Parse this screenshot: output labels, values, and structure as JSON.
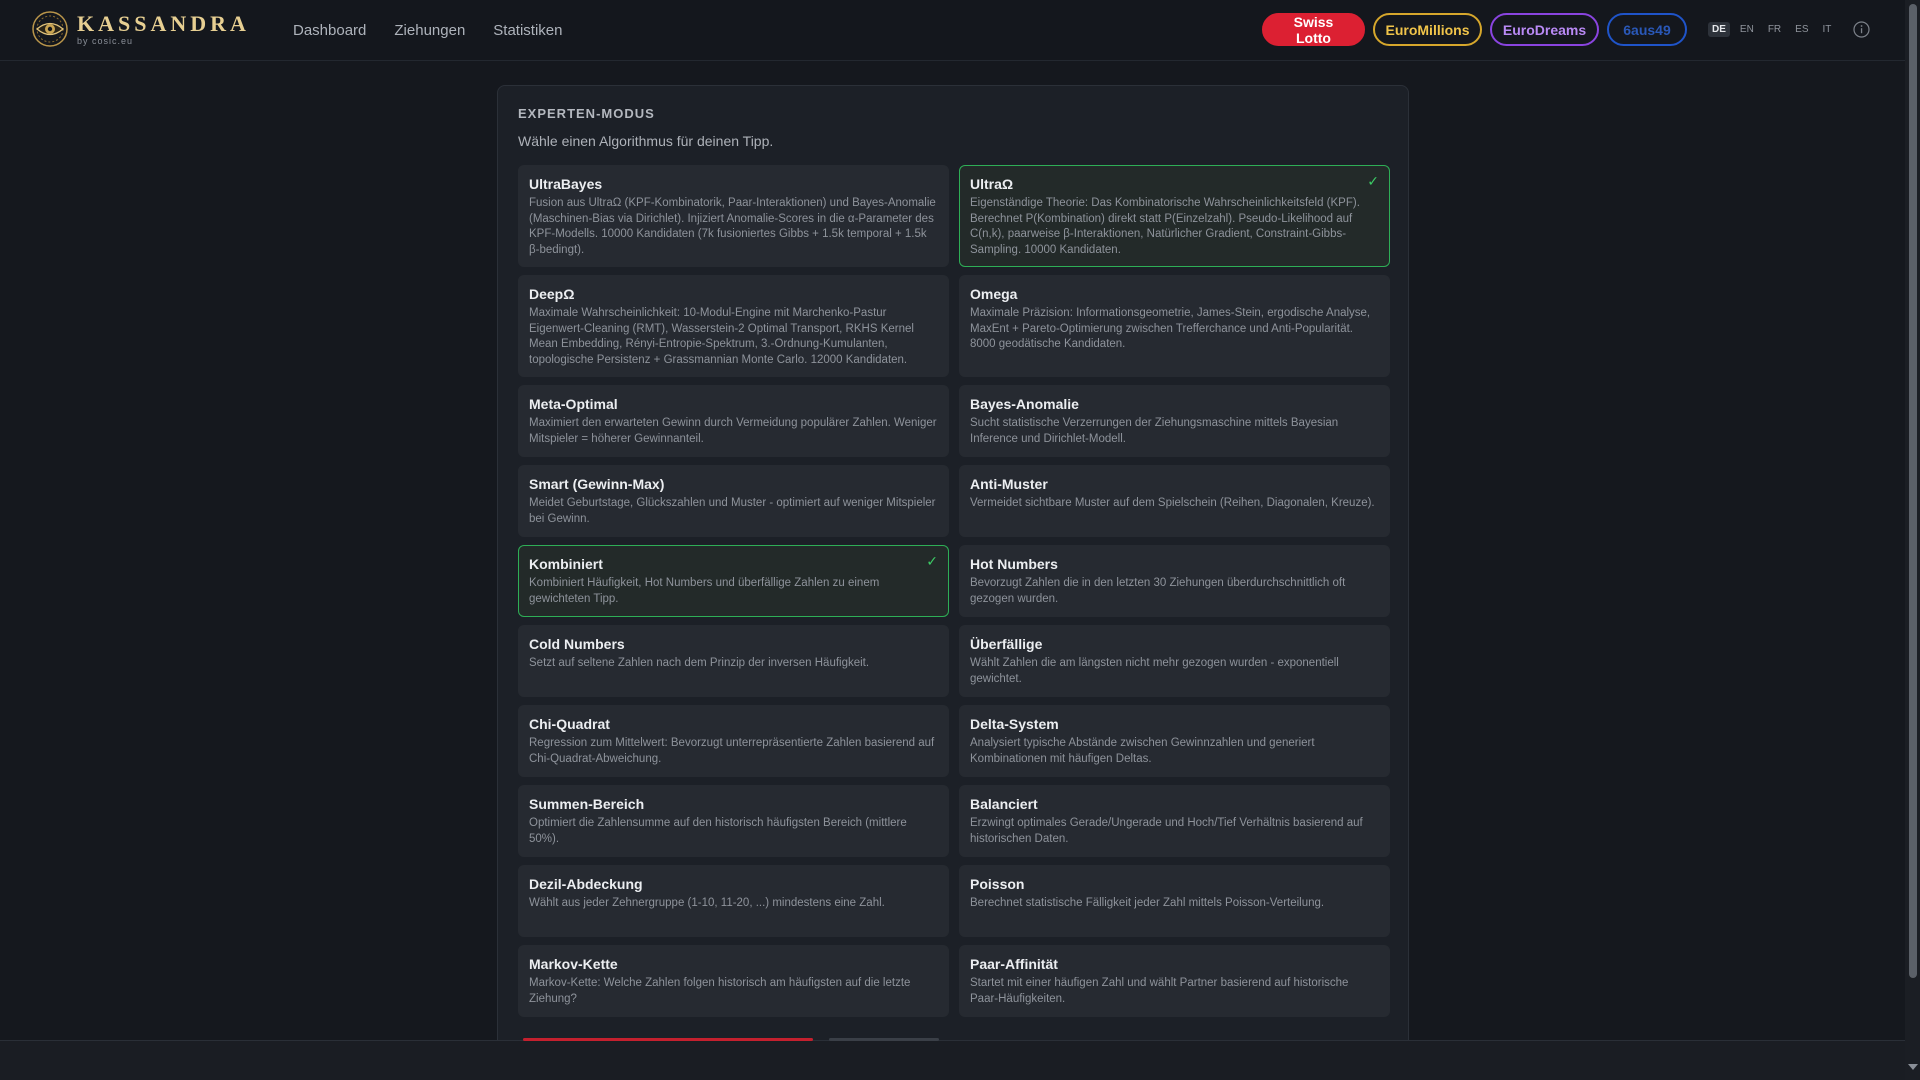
{
  "app": {
    "logo_name": "KASSANDRA",
    "logo_sub": "by cosic.eu"
  },
  "nav": {
    "items": [
      "Dashboard",
      "Ziehungen",
      "Statistiken"
    ]
  },
  "games": [
    {
      "label": "Swiss Lotto",
      "color": "#dc2032"
    },
    {
      "label": "EuroMillions",
      "color": "#d6a72c"
    },
    {
      "label": "EuroDreams",
      "color": "#8a44e0"
    },
    {
      "label": "6aus49",
      "color": "#1f54c9"
    }
  ],
  "languages": {
    "items": [
      "DE",
      "EN",
      "FR",
      "ES",
      "IT"
    ],
    "active": "DE"
  },
  "icons": {
    "info": "info-icon",
    "check": "check-icon",
    "logo": "eye-logo-icon"
  },
  "panel": {
    "title": "EXPERTEN-MODUS",
    "subtitle": "Wähle einen Algorithmus für deinen Tipp."
  },
  "algorithms": [
    {
      "title": "UltraBayes",
      "selected": false,
      "desc": "Fusion aus UltraΩ (KPF-Kombinatorik, Paar-Interaktionen) und Bayes-Anomalie (Maschinen-Bias via Dirichlet). Injiziert Anomalie-Scores in die α-Parameter des KPF-Modells. 10000 Kandidaten (7k fusioniertes Gibbs + 1.5k temporal + 1.5k β-bedingt)."
    },
    {
      "title": "UltraΩ",
      "selected": true,
      "desc": "Eigenständige Theorie: Das Kombinatorische Wahrscheinlichkeitsfeld (KPF). Berechnet P(Kombination) direkt statt P(Einzelzahl). Pseudo-Likelihood auf C(n,k), paarweise β-Interaktionen, Natürlicher Gradient, Constraint-Gibbs-Sampling. 10000 Kandidaten."
    },
    {
      "title": "DeepΩ",
      "selected": false,
      "desc": "Maximale Wahrscheinlichkeit: 10-Modul-Engine mit Marchenko-Pastur Eigenwert-Cleaning (RMT), Wasserstein-2 Optimal Transport, RKHS Kernel Mean Embedding, Rényi-Entropie-Spektrum, 3.-Ordnung-Kumulanten, topologische Persistenz + Grassmannian Monte Carlo. 12000 Kandidaten."
    },
    {
      "title": "Omega",
      "selected": false,
      "desc": "Maximale Präzision: Informationsgeometrie, James-Stein, ergodische Analyse, MaxEnt + Pareto-Optimierung zwischen Trefferchance und Anti-Popularität. 8000 geodätische Kandidaten."
    },
    {
      "title": "Meta-Optimal",
      "selected": false,
      "desc": "Maximiert den erwarteten Gewinn durch Vermeidung populärer Zahlen. Weniger Mitspieler = höherer Gewinnanteil."
    },
    {
      "title": "Bayes-Anomalie",
      "selected": false,
      "desc": "Sucht statistische Verzerrungen der Ziehungsmaschine mittels Bayesian Inference und Dirichlet-Modell."
    },
    {
      "title": "Smart (Gewinn-Max)",
      "selected": false,
      "desc": "Meidet Geburtstage, Glückszahlen und Muster - optimiert auf weniger Mitspieler bei Gewinn."
    },
    {
      "title": "Anti-Muster",
      "selected": false,
      "desc": "Vermeidet sichtbare Muster auf dem Spielschein (Reihen, Diagonalen, Kreuze)."
    },
    {
      "title": "Kombiniert",
      "selected": true,
      "desc": "Kombiniert Häufigkeit, Hot Numbers und überfällige Zahlen zu einem gewichteten Tipp."
    },
    {
      "title": "Hot Numbers",
      "selected": false,
      "desc": "Bevorzugt Zahlen die in den letzten 30 Ziehungen überdurchschnittlich oft gezogen wurden."
    },
    {
      "title": "Cold Numbers",
      "selected": false,
      "desc": "Setzt auf seltene Zahlen nach dem Prinzip der inversen Häufigkeit."
    },
    {
      "title": "Überfällige",
      "selected": false,
      "desc": "Wählt Zahlen die am längsten nicht mehr gezogen wurden - exponentiell gewichtet."
    },
    {
      "title": "Chi-Quadrat",
      "selected": false,
      "desc": "Regression zum Mittelwert: Bevorzugt unterrepräsentierte Zahlen basierend auf Chi-Quadrat-Abweichung."
    },
    {
      "title": "Delta-System",
      "selected": false,
      "desc": "Analysiert typische Abstände zwischen Gewinnzahlen und generiert Kombinationen mit häufigen Deltas."
    },
    {
      "title": "Summen-Bereich",
      "selected": false,
      "desc": "Optimiert die Zahlensumme auf den historisch häufigsten Bereich (mittlere 50%)."
    },
    {
      "title": "Balanciert",
      "selected": false,
      "desc": "Erzwingt optimales Gerade/Ungerade und Hoch/Tief Verhältnis basierend auf historischen Daten."
    },
    {
      "title": "Dezil-Abdeckung",
      "selected": false,
      "desc": "Wählt aus jeder Zehnergruppe (1-10, 11-20, ...) mindestens eine Zahl."
    },
    {
      "title": "Poisson",
      "selected": false,
      "desc": "Berechnet statistische Fälligkeit jeder Zahl mittels Poisson-Verteilung."
    },
    {
      "title": "Markov-Kette",
      "selected": false,
      "desc": "Markov-Kette: Welche Zahlen folgen historisch am häufigsten auf die letzte Ziehung?"
    },
    {
      "title": "Paar-Affinität",
      "selected": false,
      "desc": "Startet mit einer häufigen Zahl und wählt Partner basierend auf historische Paar-Häufigkeiten."
    }
  ]
}
